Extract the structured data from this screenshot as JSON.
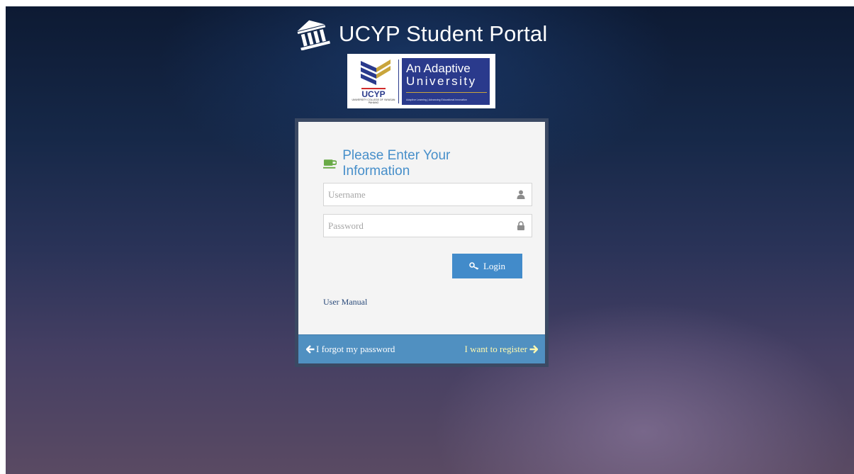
{
  "header": {
    "title": "UCYP Student Portal",
    "title_icon": "bank-building-icon"
  },
  "logo": {
    "wordmark": "UCYP",
    "subtext": "UNIVERSITY COLLEGE OF YAYASAN PAHANG",
    "banner_line1": "An Adaptive",
    "banner_line2": "University",
    "banner_tagline": "Adaptive Learning | Advancing Educational Innovation"
  },
  "login": {
    "heading": "Please Enter Your Information",
    "heading_icon": "coffee-icon",
    "username_placeholder": "Username",
    "username_value": "",
    "password_placeholder": "Password",
    "password_value": "",
    "login_label": "Login",
    "user_manual_label": "User Manual",
    "forgot_label": "I forgot my password",
    "register_label": "I want to register"
  },
  "colors": {
    "accent": "#478fca",
    "button": "#428bca",
    "footer": "#5090c1",
    "register_text": "#fef9b0",
    "coffee_icon": "#69aa46"
  }
}
